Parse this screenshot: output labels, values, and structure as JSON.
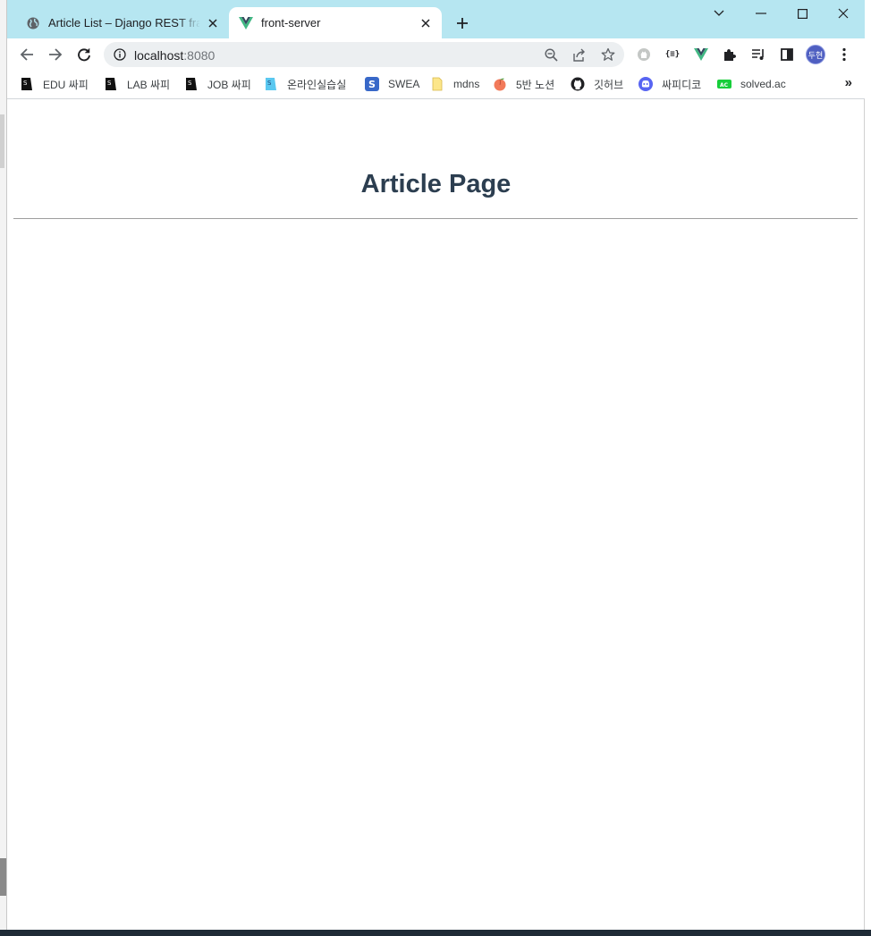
{
  "browser": {
    "tabs": [
      {
        "title": "Article List – Django REST frame",
        "favicon": "globe-icon",
        "active": false
      },
      {
        "title": "front-server",
        "favicon": "vue-logo-icon",
        "active": true
      }
    ],
    "address": {
      "host": "localhost",
      "port": ":8080"
    },
    "profile_initials": "두현",
    "bookmarks": [
      {
        "label": "EDU 싸피",
        "icon": "ssafy-bookmark-icon"
      },
      {
        "label": "LAB 싸피",
        "icon": "ssafy-bookmark-icon"
      },
      {
        "label": "JOB 싸피",
        "icon": "ssafy-bookmark-icon"
      },
      {
        "label": "온라인실습실",
        "icon": "ssafy-online-icon"
      },
      {
        "label": "SWEA",
        "icon": "swea-icon"
      },
      {
        "label": "mdns",
        "icon": "folder-icon"
      },
      {
        "label": "5반 노션",
        "icon": "peach-icon"
      },
      {
        "label": "깃허브",
        "icon": "github-icon"
      },
      {
        "label": "싸피디코",
        "icon": "discord-icon"
      },
      {
        "label": "solved.ac",
        "icon": "solvedac-icon"
      }
    ],
    "more_bookmarks": "»"
  },
  "page": {
    "title": "Article Page"
  },
  "colors": {
    "tabstrip": "#b6e6f1",
    "heading": "#2c3e50",
    "avatar": "#4f5fc1"
  }
}
